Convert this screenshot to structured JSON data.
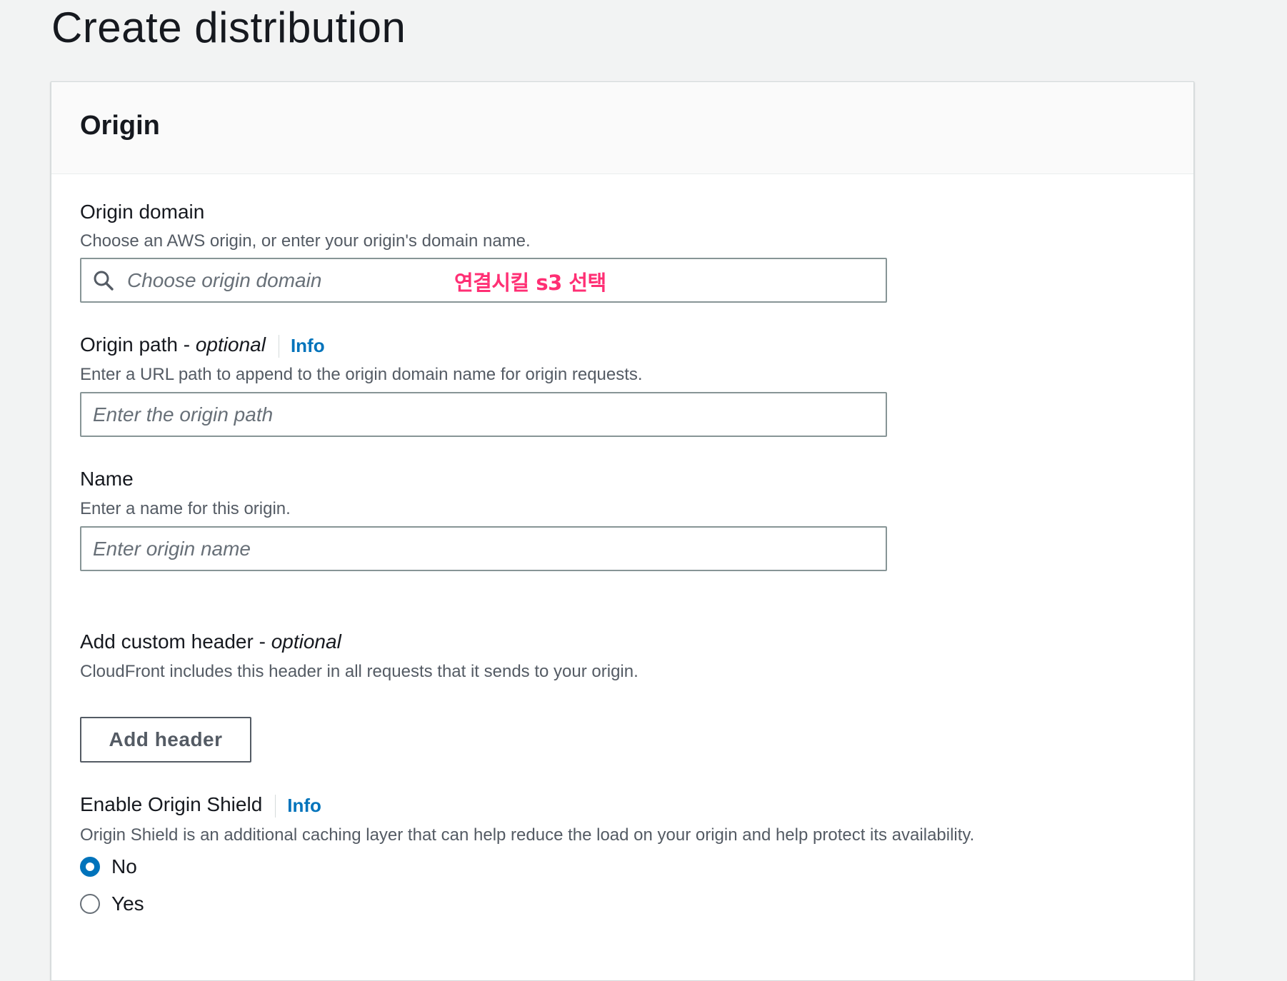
{
  "page": {
    "title": "Create distribution"
  },
  "origin_panel": {
    "title": "Origin",
    "origin_domain": {
      "label": "Origin domain",
      "description": "Choose an AWS origin, or enter your origin's domain name.",
      "placeholder": "Choose origin domain",
      "value": "",
      "icon": "search-icon",
      "annotation": "연결시킬 s3 선택",
      "annotation_color": "#ff2f74"
    },
    "origin_path": {
      "label": "Origin path - ",
      "label_optional": "optional",
      "info": "Info",
      "description": "Enter a URL path to append to the origin domain name for origin requests.",
      "placeholder": "Enter the origin path",
      "value": ""
    },
    "name": {
      "label": "Name",
      "description": "Enter a name for this origin.",
      "placeholder": "Enter origin name",
      "value": ""
    },
    "custom_header": {
      "label": "Add custom header - ",
      "label_optional": "optional",
      "description": "CloudFront includes this header in all requests that it sends to your origin.",
      "button_label": "Add header"
    },
    "origin_shield": {
      "label": "Enable Origin Shield",
      "info": "Info",
      "description": "Origin Shield is an additional caching layer that can help reduce the load on your origin and help protect its availability.",
      "options": [
        {
          "label": "No",
          "selected": true
        },
        {
          "label": "Yes",
          "selected": false
        }
      ]
    }
  },
  "colors": {
    "accent": "#0073bb",
    "page_background": "#f2f3f3",
    "text_primary": "#16191f",
    "text_secondary": "#545b64"
  }
}
